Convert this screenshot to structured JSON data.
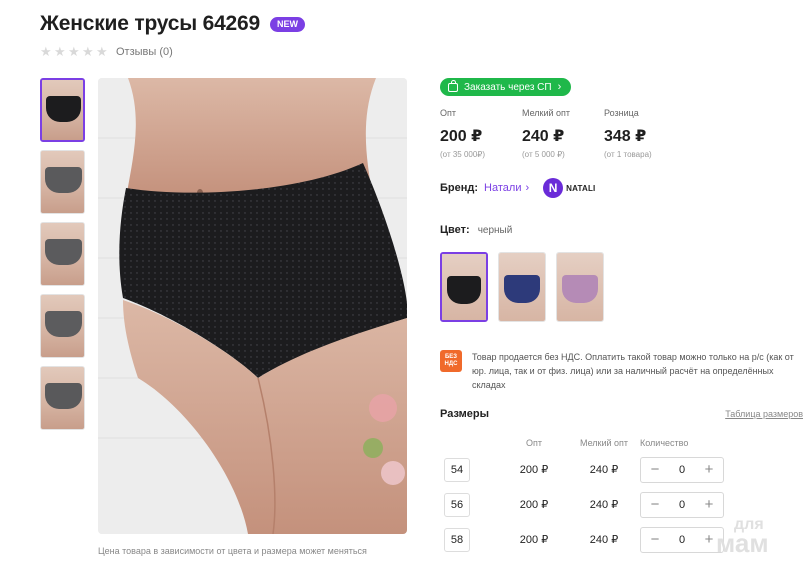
{
  "product": {
    "title": "Женские трусы 64269",
    "badge": "NEW",
    "reviews_label": "Отзывы (0)",
    "rating_stars": 5,
    "rating_filled": 0
  },
  "gallery": {
    "thumbnails": [
      {
        "color": "#1c1c1e",
        "active": true
      },
      {
        "color": "#5a5a5c",
        "active": false
      },
      {
        "color": "#5b5b5d",
        "active": false
      },
      {
        "color": "#5c5c5e",
        "active": false
      },
      {
        "color": "#59595b",
        "active": false
      }
    ],
    "price_note": "Цена товара в зависимости от цвета и размера может меняться"
  },
  "order": {
    "sp_button_label": "Заказать через СП"
  },
  "prices": [
    {
      "label": "Опт",
      "value": "200 ₽",
      "sub": "(от 35 000₽)"
    },
    {
      "label": "Мелкий опт",
      "value": "240 ₽",
      "sub": "(от 5 000 ₽)"
    },
    {
      "label": "Розница",
      "value": "348 ₽",
      "sub": "(от 1 товара)"
    }
  ],
  "brand": {
    "label": "Бренд:",
    "name": "Натали",
    "logo_letter": "N",
    "logo_text": "NATALI"
  },
  "color": {
    "label": "Цвет:",
    "value": "черный",
    "swatches": [
      {
        "color": "#1c1c1e",
        "active": true
      },
      {
        "color": "#2d3a7a",
        "active": false
      },
      {
        "color": "#b58bb6",
        "active": false
      }
    ]
  },
  "vat": {
    "icon_text": "БЕЗ НДС",
    "text": "Товар продается без НДС. Оплатить такой товар можно только на р/с (как от юр. лица, так и от физ. лица) или за наличный расчёт на определённых складах"
  },
  "sizes": {
    "title": "Размеры",
    "table_link": "Таблица размеров",
    "headers": {
      "opt": "Опт",
      "small_opt": "Мелкий опт",
      "qty": "Количество"
    },
    "rows": [
      {
        "size": "54",
        "opt": "200 ₽",
        "small_opt": "240 ₽",
        "qty": "0"
      },
      {
        "size": "56",
        "opt": "200 ₽",
        "small_opt": "240 ₽",
        "qty": "0"
      },
      {
        "size": "58",
        "opt": "200 ₽",
        "small_opt": "240 ₽",
        "qty": "0"
      }
    ],
    "minus": "−",
    "plus": "+"
  },
  "watermark": {
    "line1": "для",
    "line2": "мам"
  },
  "colors": {
    "accent": "#7b3fe4",
    "green": "#1fb84a",
    "vat": "#f06a2b"
  }
}
